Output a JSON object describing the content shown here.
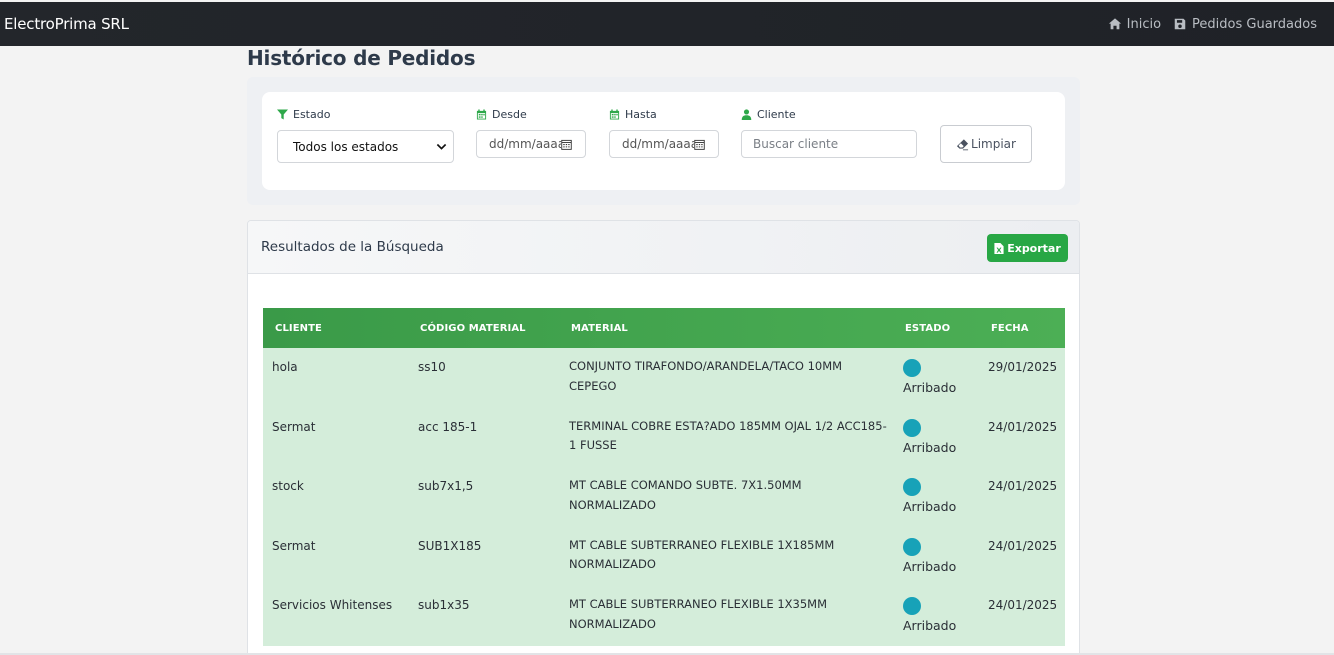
{
  "navbar": {
    "brand": "ElectroPrima SRL",
    "links": [
      {
        "label": "Inicio",
        "icon": "home-icon"
      },
      {
        "label": "Pedidos Guardados",
        "icon": "save-icon"
      }
    ]
  },
  "page": {
    "title": "Histórico de Pedidos"
  },
  "filters": {
    "estado": {
      "label": "Estado",
      "value": "Todos los estados"
    },
    "desde": {
      "label": "Desde",
      "value": "dd/mm/aaaa"
    },
    "hasta": {
      "label": "Hasta",
      "value": "dd/mm/aaaa"
    },
    "cliente": {
      "label": "Cliente",
      "placeholder": "Buscar cliente"
    },
    "clear_label": "Limpiar"
  },
  "results": {
    "title": "Resultados de la Búsqueda",
    "export_label": "Exportar",
    "columns": [
      "CLIENTE",
      "CÓDIGO MATERIAL",
      "MATERIAL",
      "ESTADO",
      "FECHA"
    ],
    "rows": [
      {
        "cliente": "hola",
        "codigo": "ss10",
        "material": "CONJUNTO TIRAFONDO/ARANDELA/TACO 10MM CEPEGO",
        "estado": "Arribado",
        "fecha": "29/01/2025"
      },
      {
        "cliente": "Sermat",
        "codigo": "acc 185-1",
        "material": "TERMINAL COBRE ESTA?ADO 185MM OJAL 1/2 ACC185-1 FUSSE",
        "estado": "Arribado",
        "fecha": "24/01/2025"
      },
      {
        "cliente": "stock",
        "codigo": "sub7x1,5",
        "material": "MT CABLE COMANDO SUBTE. 7X1.50MM NORMALIZADO",
        "estado": "Arribado",
        "fecha": "24/01/2025"
      },
      {
        "cliente": "Sermat",
        "codigo": "SUB1X185",
        "material": "MT CABLE SUBTERRANEO FLEXIBLE 1X185MM NORMALIZADO",
        "estado": "Arribado",
        "fecha": "24/01/2025"
      },
      {
        "cliente": "Servicios Whitenses",
        "codigo": "sub1x35",
        "material": "MT CABLE SUBTERRANEO FLEXIBLE 1X35MM NORMALIZADO",
        "estado": "Arribado",
        "fecha": "24/01/2025"
      }
    ]
  },
  "colors": {
    "accent": "#28a745",
    "row_bg": "#d4edda",
    "status_dot": "#17a2b8",
    "navbar": "#212529"
  }
}
